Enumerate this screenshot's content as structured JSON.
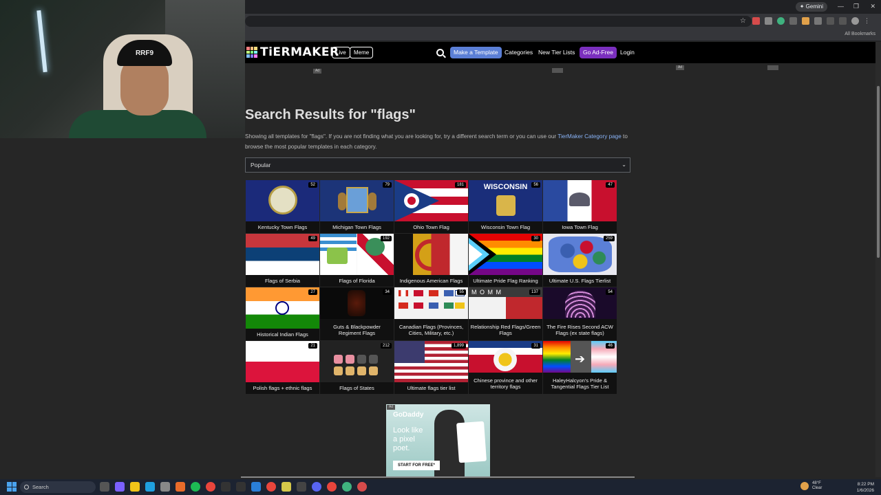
{
  "browser": {
    "gemini_label": "✦ Gemini",
    "all_bookmarks": "All Bookmarks"
  },
  "webcam": {
    "cap_text": "RRF9"
  },
  "site": {
    "logo": "TiERMAKER",
    "nav": {
      "live": "Live",
      "meme": "Meme",
      "make_template": "Make a Template",
      "categories": "Categories",
      "new_tier_lists": "New Tier Lists",
      "go_ad_free": "Go Ad-Free",
      "login": "Login"
    },
    "ad_label": "Ad",
    "results_title": "Search Results for \"flags\"",
    "desc_prefix": "Showing all templates for \"flags\". If you are not finding what you are looking for, try a different search term or you can use our ",
    "desc_link": "TierMaker Category page",
    "desc_suffix": " to browse the most popular templates in each category.",
    "sort_value": "Popular"
  },
  "cards": [
    {
      "label": "Kentucky Town Flags",
      "count": "52"
    },
    {
      "label": "Michigan Town Flags",
      "count": "79"
    },
    {
      "label": "Ohio Town Flag",
      "count": "181"
    },
    {
      "label": "Wisconsin Town Flag",
      "count": "56",
      "thumb_text": "WISCONSIN"
    },
    {
      "label": "Iowa Town Flag",
      "count": "47"
    },
    {
      "label": "Flags of Serbia",
      "count": "49"
    },
    {
      "label": "Flags of Florida",
      "count": "192"
    },
    {
      "label": "Indigenous American Flags",
      "count": ""
    },
    {
      "label": "Ultimate Pride Flag Ranking",
      "count": "30"
    },
    {
      "label": "Ultimate U.S. Flags Tierlist",
      "count": "259"
    },
    {
      "label": "Historical Indian Flags",
      "count": "27"
    },
    {
      "label": "Guts & Blackpowder Regiment Flags",
      "count": "34"
    },
    {
      "label": "Canadian Flags (Provinces, Cities, Military, etc.)",
      "count": "55"
    },
    {
      "label": "Relationship Red Flags/Green Flags",
      "count": "137",
      "thumb_text": "M  O  M  M"
    },
    {
      "label": "The Fire Rises Second ACW Flags (ex state flags)",
      "count": "54"
    },
    {
      "label": "Polish flags + ethnic flags",
      "count": "21"
    },
    {
      "label": "Flags of States",
      "count": "212"
    },
    {
      "label": "Ultimate flags tier list",
      "count": "1,899"
    },
    {
      "label": "Chinese province and other territory flags",
      "count": "31"
    },
    {
      "label": "HaleyHalcyon's Pride & Tangential Flags Tier List",
      "count": "46"
    }
  ],
  "ad": {
    "brand": "GoDaddy",
    "copy_line1": "Look like",
    "copy_line2": "a pixel",
    "copy_line3": "poet.",
    "cta": "START FOR FREE*"
  },
  "taskbar": {
    "search": "Search",
    "weather_temp": "48°F",
    "weather_desc": "Clear",
    "time": "8:22 PM",
    "date": "1/6/2026"
  },
  "colors": {
    "accent_blue": "#5b7fd6",
    "accent_purple": "#7b2fbe",
    "link": "#8ab4f8"
  }
}
